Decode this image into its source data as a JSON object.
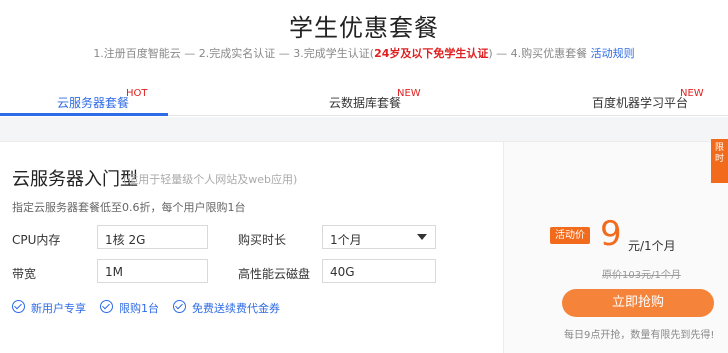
{
  "header": {
    "title": "学生优惠套餐",
    "steps_part1": "1.注册百度智能云 — 2.完成实名认证 — 3.完成学生认证(",
    "steps_highlight": "24岁及以下免学生认证",
    "steps_part2": ") — 4.购买优惠套餐",
    "rules_link": "活动规则"
  },
  "tabs": [
    {
      "label": "云服务器套餐",
      "badge": "HOT",
      "active": true
    },
    {
      "label": "云数据库套餐",
      "badge": "NEW",
      "active": false
    },
    {
      "label": "百度机器学习平台",
      "badge": "NEW",
      "active": false
    }
  ],
  "card": {
    "title": "云服务器入门型",
    "subtitle": "(适用于轻量级个人网站及web应用)",
    "description": "指定云服务器套餐低至0.6折，每个用户限购1台",
    "fields": {
      "cpu_label": "CPU内存",
      "cpu_value": "1核 2G",
      "duration_label": "购买时长",
      "duration_value": "1个月",
      "bandwidth_label": "带宽",
      "bandwidth_value": "1M",
      "disk_label": "高性能云磁盘",
      "disk_value": "40G"
    },
    "features": [
      "新用户专享",
      "限购1台",
      "免费送续费代金券"
    ]
  },
  "pricing": {
    "badge": "活动价",
    "price": "9",
    "unit": "元/1个月",
    "original": "原价103元/1个月",
    "buy_label": "立即抢购",
    "note": "每日9点开抢，数量有限先到先得!"
  },
  "ribbon": "限时",
  "colors": {
    "accent_blue": "#2e6be6",
    "accent_orange": "#f26a1b",
    "highlight_red": "#e02020"
  }
}
